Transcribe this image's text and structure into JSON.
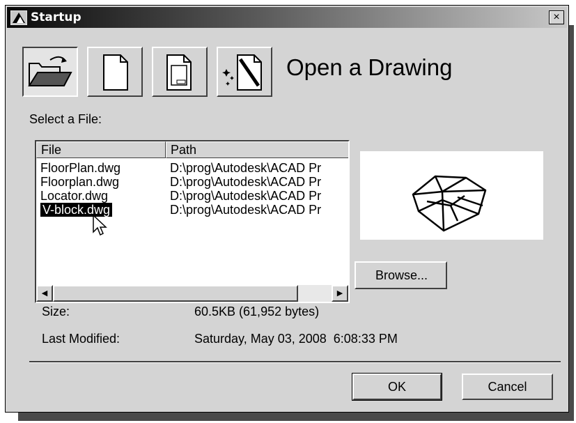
{
  "window": {
    "title": "Startup",
    "close_glyph": "×"
  },
  "toolbar": {
    "buttons": [
      {
        "icon": "open-folder-icon",
        "label": "Open a Drawing",
        "pressed": true
      },
      {
        "icon": "blank-page-icon",
        "label": "Start from Scratch",
        "pressed": false
      },
      {
        "icon": "template-page-icon",
        "label": "Use a Template",
        "pressed": false
      },
      {
        "icon": "wizard-icon",
        "label": "Use a Wizard",
        "pressed": false
      }
    ]
  },
  "heading": "Open a Drawing",
  "select_label": "Select a File:",
  "file_list": {
    "columns": [
      "File",
      "Path"
    ],
    "rows": [
      {
        "file": "FloorPlan.dwg",
        "path": "D:\\prog\\Autodesk\\ACAD Pr"
      },
      {
        "file": "Floorplan.dwg",
        "path": "D:\\prog\\Autodesk\\ACAD Pr"
      },
      {
        "file": "Locator.dwg",
        "path": "D:\\prog\\Autodesk\\ACAD Pr"
      },
      {
        "file": "V-block.dwg",
        "path": "D:\\prog\\Autodesk\\ACAD Pr",
        "selected": true
      }
    ]
  },
  "browse_label": "Browse...",
  "details": {
    "size_label": "Size:",
    "size_value": "60.5KB (61,952 bytes)",
    "modified_label": "Last Modified:",
    "modified_value": "Saturday, May 03, 2008  6:08:33 PM"
  },
  "ok_label": "OK",
  "cancel_label": "Cancel",
  "colors": {
    "dialog_bg": "#d4d4d4",
    "selection": "#000000"
  }
}
